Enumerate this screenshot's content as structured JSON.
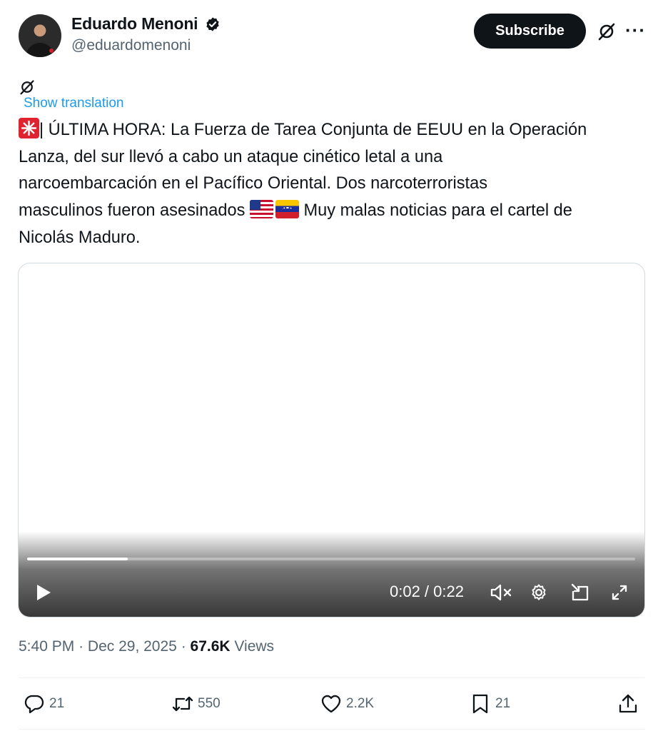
{
  "author": {
    "name": "Eduardo Menoni",
    "handle": "@eduardomenoni",
    "verified": true
  },
  "header": {
    "subscribe_label": "Subscribe",
    "grok_icon": "grok-icon",
    "more_label": "···"
  },
  "translation": {
    "show_label": "Show translation"
  },
  "tweet": {
    "segments": [
      "| ÚLTIMA HORA: La Fuerza de Tarea Conjunta de EEUU en la Operación",
      "Lanza, del sur llevó a cabo un ataque cinético letal a una",
      "narcoembarcación en el Pacífico Oriental. Dos narcoterroristas",
      "masculinos fueron asesinados",
      "Muy malas noticias para el cartel de",
      "Nicolás Maduro."
    ],
    "emojis": [
      "rotating-light-emoji",
      "us-flag-emoji",
      "venezuela-flag-emoji"
    ]
  },
  "video": {
    "time_label": "0:02 / 0:22",
    "progress": 0.165,
    "muted": true
  },
  "meta": {
    "time": "5:40 PM",
    "separator": "·",
    "date": "Dec 29, 2025",
    "views_count": "67.6K",
    "views_label": "Views"
  },
  "actions": {
    "replies": "21",
    "reposts": "550",
    "likes": "2.2K",
    "bookmarks": "21"
  },
  "colors": {
    "accent": "#1d9bf0",
    "text": "#0f1419",
    "secondary": "#536471",
    "border": "#cfd9de"
  }
}
